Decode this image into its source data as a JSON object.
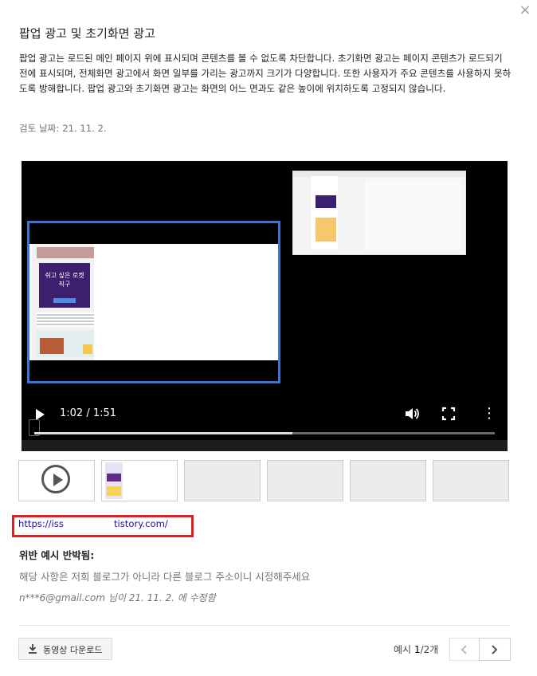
{
  "dialog": {
    "close_glyph": "×",
    "title": "팝업 광고 및 초기화면 광고",
    "description": "팝업 광고는 로드된 메인 페이지 위에 표시되며 콘텐츠를 볼 수 없도록 차단합니다. 초기화면 광고는 페이지 콘텐츠가 로드되기 전에 표시되며, 전체화면 광고에서 화면 일부를 가리는 광고까지 크기가 다양합니다. 또한 사용자가 주요 콘텐츠를 사용하지 못하도록 방해합니다. 팝업 광고와 초기화면 광고는 화면의 어느 면과도 같은 높이에 위치하도록 고정되지 않습니다.",
    "review_label": "검토 날짜:",
    "review_date": "21. 11. 2."
  },
  "player": {
    "current_time": "1:02",
    "duration": "1:51",
    "time_text": "1:02 / 1:51",
    "progress_fraction": 0.56,
    "more_glyph": "⋮",
    "promo_text": "쉬고 싶은 로켓직구"
  },
  "thumbnails": {
    "count": 6,
    "selected_index": 0
  },
  "example_url": {
    "part_a": "https://iss",
    "part_b": "tistory.com/"
  },
  "appeal": {
    "title": "위반 예시 반박됨:",
    "text": "해당 사항은 저희 블로그가 아니라 다른 블로그 주소이니 시정해주세요",
    "meta": "n***6@gmail.com 님이 21. 11. 2. 에 수정함"
  },
  "footer": {
    "download_label": "동영상 다운로드",
    "pager_prefix": "예시 ",
    "pager_current": "1",
    "pager_suffix": "/2개"
  },
  "colors": {
    "highlight_border": "#e02020",
    "link": "#1a0dab",
    "frame_border": "#3b73d6"
  }
}
